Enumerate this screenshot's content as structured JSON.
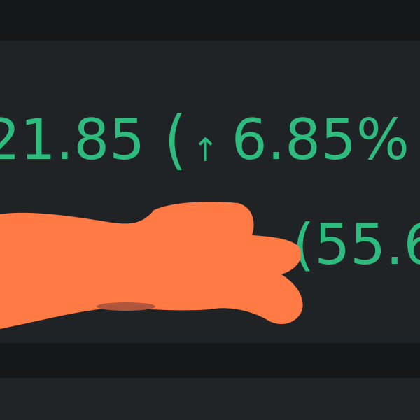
{
  "quote": {
    "price": "21.85",
    "change_open_paren": "(",
    "change_icon": "arrow-up-icon",
    "change_arrow_glyph": "↑",
    "change_percent": "6.85%",
    "change_color": "#2dbb7e"
  },
  "secondary": {
    "value_partial": "(55.6"
  },
  "redaction": {
    "color": "#ff7a45"
  },
  "colors": {
    "background": "#16181b",
    "card": "#202326",
    "positive": "#2dbb7e"
  }
}
